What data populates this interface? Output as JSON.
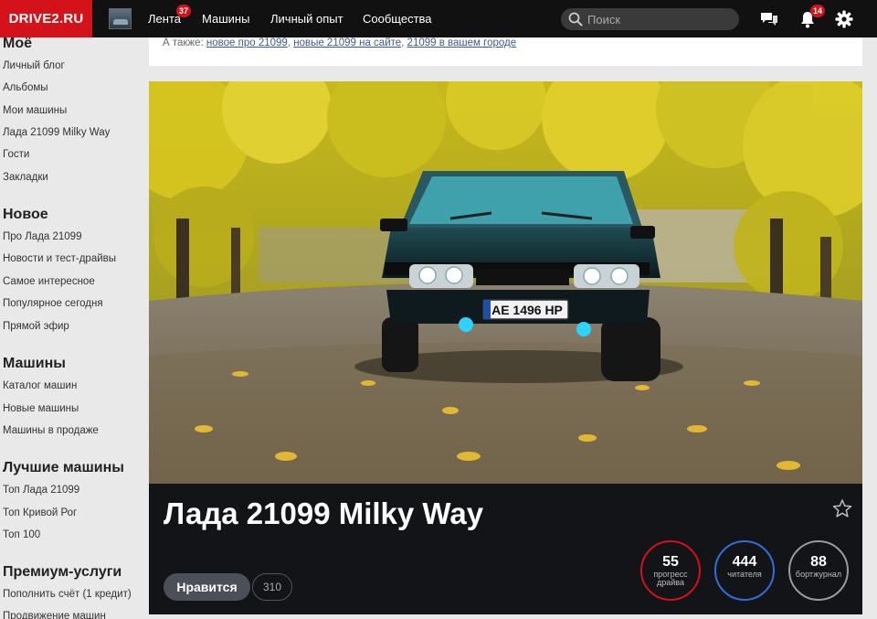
{
  "header": {
    "logo": "DRIVE2.RU",
    "nav": [
      {
        "label": "Лента",
        "badge": "37"
      },
      {
        "label": "Машины"
      },
      {
        "label": "Личный опыт"
      },
      {
        "label": "Сообщества"
      }
    ],
    "search_placeholder": "Поиск",
    "notifications_badge": "14",
    "colors": {
      "brand": "#d4121a",
      "bar": "#111111"
    }
  },
  "sidebar": {
    "sections": [
      {
        "title": "Моё",
        "items": [
          "Личный блог",
          "Альбомы",
          "Мои машины",
          "Лада 21099 Milky Way",
          "Гости",
          "Закладки"
        ]
      },
      {
        "title": "Новое",
        "items": [
          "Про Лада 21099",
          "Новости и тест-драйвы",
          "Самое интересное",
          "Популярное сегодня",
          "Прямой эфир"
        ]
      },
      {
        "title": "Машины",
        "items": [
          "Каталог машин",
          "Новые машины",
          "Машины в продаже"
        ]
      },
      {
        "title": "Лучшие машины",
        "items": [
          "Топ Лада 21099",
          "Топ Кривой Рог",
          "Топ 100"
        ]
      },
      {
        "title": "Премиум-услуги",
        "items": [
          "Пополнить счёт (1 кредит)",
          "Продвижение машин"
        ]
      }
    ]
  },
  "also": {
    "prefix": "А также:",
    "links": [
      "новое про 21099",
      "новые 21099 на сайте",
      "21099 в вашем городе"
    ]
  },
  "car": {
    "title": "Лада 21099 Milky Way",
    "plate": "AE 1496 HP",
    "like_label": "Нравится",
    "like_count": "310",
    "stats": [
      {
        "value": "55",
        "label": "прогресс драйва",
        "color": "#d4121a"
      },
      {
        "value": "444",
        "label": "читателя",
        "color": "#2f6fd6"
      },
      {
        "value": "88",
        "label": "бортжурнал",
        "color": "#9a9a9a"
      }
    ]
  }
}
